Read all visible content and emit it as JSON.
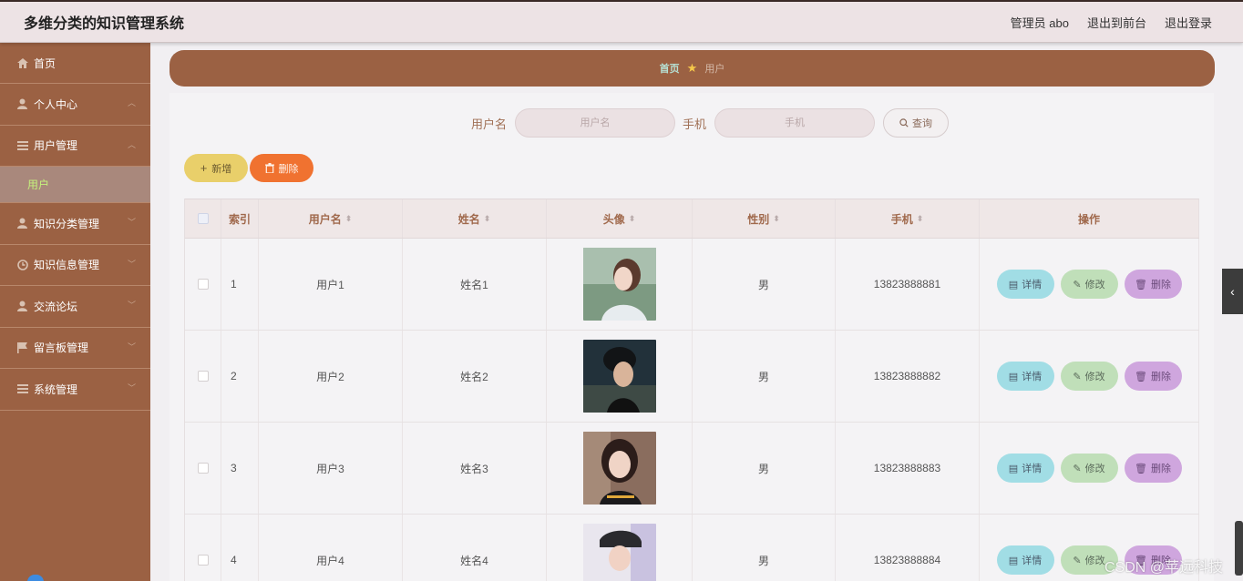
{
  "header": {
    "title": "多维分类的知识管理系统",
    "admin": "管理员 abo",
    "front": "退出到前台",
    "logout": "退出登录"
  },
  "sidebar": {
    "items": [
      {
        "label": "首页",
        "icon": "home-icon"
      },
      {
        "label": "个人中心",
        "icon": "person-icon"
      },
      {
        "label": "用户管理",
        "icon": "list-icon"
      },
      {
        "label": "用户",
        "icon": ""
      },
      {
        "label": "知识分类管理",
        "icon": "person-icon"
      },
      {
        "label": "知识信息管理",
        "icon": "clock-icon"
      },
      {
        "label": "交流论坛",
        "icon": "person-icon"
      },
      {
        "label": "留言板管理",
        "icon": "flag-icon"
      },
      {
        "label": "系统管理",
        "icon": "list-icon"
      }
    ]
  },
  "breadcrumb": {
    "home": "首页",
    "current": "用户"
  },
  "search": {
    "username_label": "用户名",
    "username_placeholder": "用户名",
    "phone_label": "手机",
    "phone_placeholder": "手机",
    "query_label": "查询"
  },
  "actions": {
    "add": "新增",
    "delete": "删除"
  },
  "table": {
    "headers": [
      "索引",
      "用户名",
      "姓名",
      "头像",
      "性别",
      "手机",
      "操作"
    ],
    "rows": [
      {
        "index": "1",
        "username": "用户1",
        "name": "姓名1",
        "gender": "男",
        "phone": "13823888881"
      },
      {
        "index": "2",
        "username": "用户2",
        "name": "姓名2",
        "gender": "男",
        "phone": "13823888882"
      },
      {
        "index": "3",
        "username": "用户3",
        "name": "姓名3",
        "gender": "男",
        "phone": "13823888883"
      },
      {
        "index": "4",
        "username": "用户4",
        "name": "姓名4",
        "gender": "男",
        "phone": "13823888884"
      }
    ],
    "ops": {
      "detail": "详情",
      "edit": "修改",
      "delete": "删除"
    }
  },
  "watermark": "CSDN @苹远科技",
  "colors": {
    "sidebar": "#9b6143",
    "header": "#ede3e5",
    "accent_add": "#e9cf6a",
    "accent_delete": "#f07230"
  }
}
